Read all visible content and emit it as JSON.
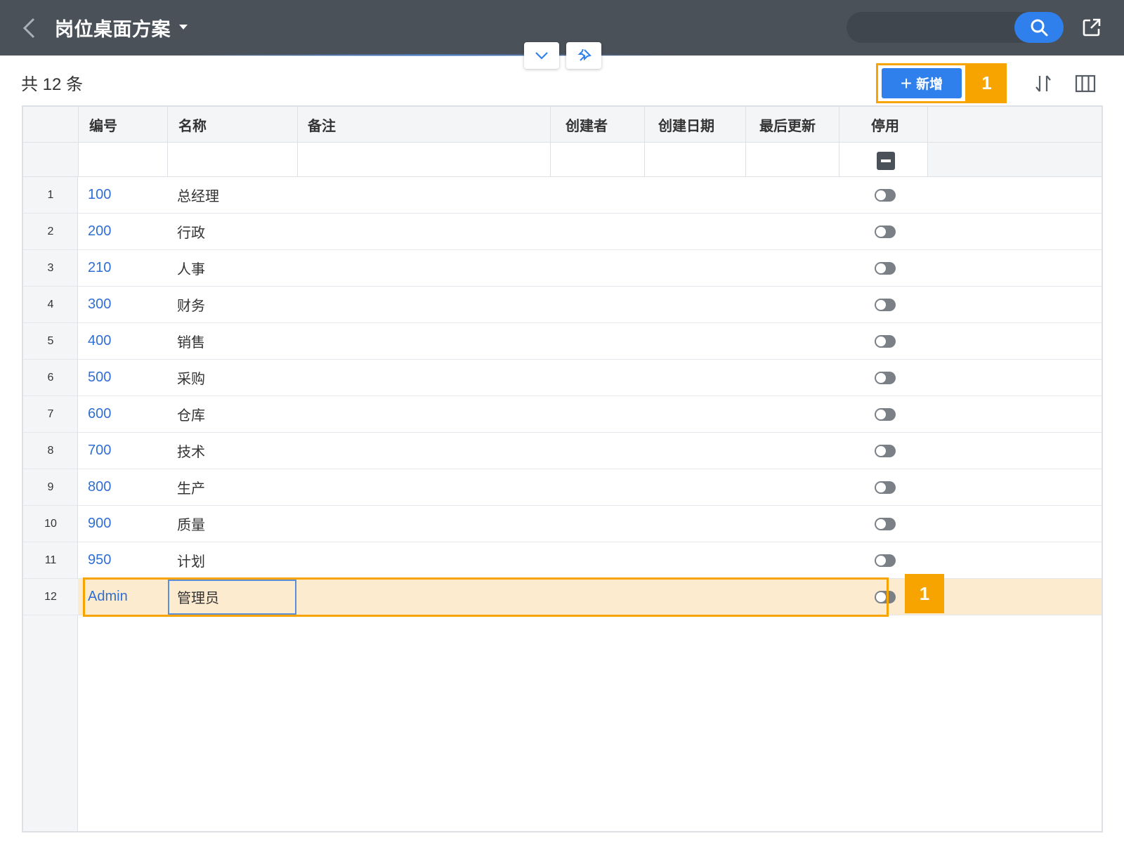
{
  "header": {
    "title": "岗位桌面方案",
    "search": {
      "placeholder": ""
    },
    "colors": {
      "bar": "#4a5159",
      "accent": "#2f80ed"
    }
  },
  "float_buttons": [
    "chevron-down-icon",
    "pin-icon"
  ],
  "toolbar": {
    "count_text": "共 12 条",
    "add_label": "新增",
    "annotation_badge": "1"
  },
  "table": {
    "columns": [
      "编号",
      "名称",
      "备注",
      "创建者",
      "创建日期",
      "最后更新",
      "停用"
    ],
    "rows": [
      {
        "num": "1",
        "code": "100",
        "name": "总经理"
      },
      {
        "num": "2",
        "code": "200",
        "name": "行政"
      },
      {
        "num": "3",
        "code": "210",
        "name": "人事"
      },
      {
        "num": "4",
        "code": "300",
        "name": "财务"
      },
      {
        "num": "5",
        "code": "400",
        "name": "销售"
      },
      {
        "num": "6",
        "code": "500",
        "name": "采购"
      },
      {
        "num": "7",
        "code": "600",
        "name": "仓库"
      },
      {
        "num": "8",
        "code": "700",
        "name": "技术"
      },
      {
        "num": "9",
        "code": "800",
        "name": "生产"
      },
      {
        "num": "10",
        "code": "900",
        "name": "质量"
      },
      {
        "num": "11",
        "code": "950",
        "name": "计划"
      },
      {
        "num": "12",
        "code": "Admin",
        "name": "管理员"
      }
    ],
    "selected_row_index": 11,
    "row_annotation_badge": "1"
  }
}
